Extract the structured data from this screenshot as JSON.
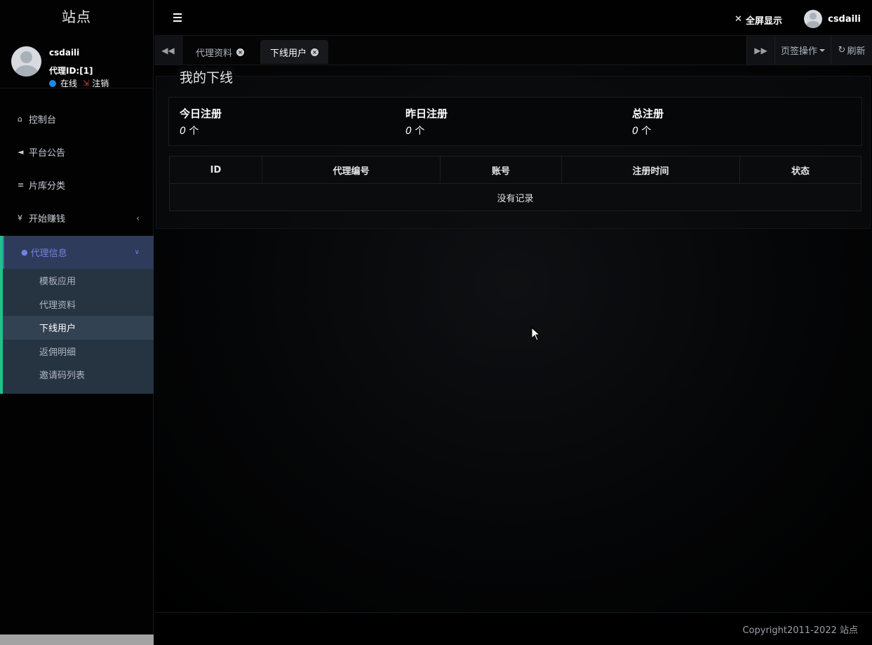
{
  "sidebar": {
    "site_title": "站点",
    "user": {
      "name": "csdaili",
      "agent_id": "代理ID:[1]",
      "online": "在线",
      "logout": "注销"
    },
    "menu": [
      {
        "label": "控制台",
        "icon": "home-icon"
      },
      {
        "label": "平台公告",
        "icon": "bullhorn-icon"
      },
      {
        "label": "片库分类",
        "icon": "list-icon"
      },
      {
        "label": "开始赚钱",
        "icon": "yen-icon"
      }
    ],
    "active_group": {
      "label": "代理信息",
      "icon": "user-icon",
      "items": [
        "模板应用",
        "代理资料",
        "下线用户",
        "返佣明细",
        "邀请码列表"
      ],
      "active_item": "下线用户"
    }
  },
  "topbar": {
    "fullscreen": "全屏显示",
    "username": "csdaili"
  },
  "tabs": {
    "items": [
      {
        "label": "代理资料"
      },
      {
        "label": "下线用户"
      }
    ],
    "active": "下线用户",
    "ops": "页签操作",
    "refresh": "刷新"
  },
  "main": {
    "title": "我的下线",
    "stats": [
      {
        "label": "今日注册",
        "value": "0",
        "unit": "个"
      },
      {
        "label": "昨日注册",
        "value": "0",
        "unit": "个"
      },
      {
        "label": "总注册",
        "value": "0",
        "unit": "个"
      }
    ],
    "table": {
      "headers": [
        "ID",
        "代理编号",
        "账号",
        "注册时间",
        "状态"
      ],
      "empty": "没有记录"
    }
  },
  "footer": {
    "copyright": "Copyright2011-2022 站点"
  },
  "colors": {
    "accent": "#7381e6",
    "active_border": "#1ec28b",
    "online_dot": "#1e88e5",
    "logout": "#e0424b"
  }
}
